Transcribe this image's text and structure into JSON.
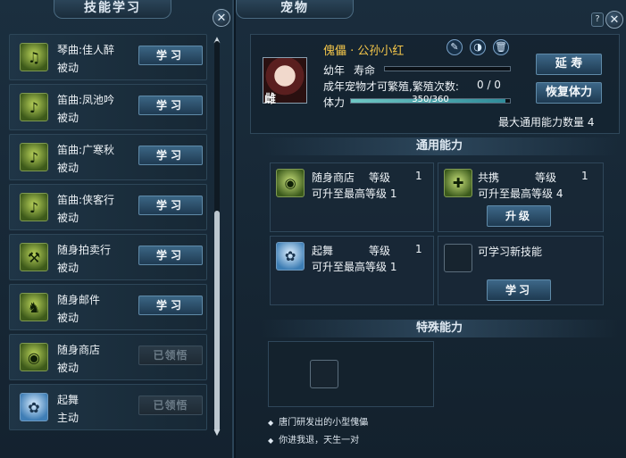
{
  "left_panel": {
    "title": "技能学习",
    "close_icon": "✕",
    "skills": [
      {
        "name": "琴曲:佳人醉",
        "type": "被动",
        "button": "学习",
        "icon": "music-instrument-icon",
        "enabled": true
      },
      {
        "name": "笛曲:凤池吟",
        "type": "被动",
        "button": "学习",
        "icon": "flute-icon",
        "enabled": true
      },
      {
        "name": "笛曲:广寒秋",
        "type": "被动",
        "button": "学习",
        "icon": "flute-icon",
        "enabled": true
      },
      {
        "name": "笛曲:侠客行",
        "type": "被动",
        "button": "学习",
        "icon": "flute-icon",
        "enabled": true
      },
      {
        "name": "随身拍卖行",
        "type": "被动",
        "button": "学习",
        "icon": "auction-hammer-icon",
        "enabled": true
      },
      {
        "name": "随身邮件",
        "type": "被动",
        "button": "学习",
        "icon": "mail-horse-icon",
        "enabled": true
      },
      {
        "name": "随身商店",
        "type": "被动",
        "button": "已领悟",
        "icon": "shop-coin-icon",
        "enabled": false
      },
      {
        "name": "起舞",
        "type": "主动",
        "button": "已领悟",
        "icon": "dance-icon",
        "enabled": false
      }
    ]
  },
  "right_panel": {
    "title": "宠物",
    "help_icon": "?",
    "close_icon": "✕",
    "pet": {
      "name": "傀儡 · 公孙小红",
      "portrait_tag": "雌",
      "youth_label": "幼年",
      "lifespan_label": "寿命",
      "lifespan_fill": 0.0,
      "breed_text": "成年宠物才可繁殖,繁殖次数:",
      "breed_count": "0 / 0",
      "stamina_label": "体力",
      "stamina_value": "350/360",
      "stamina_fill": 0.972,
      "max_ability_text": "最大通用能力数量 4"
    },
    "buttons": {
      "extend_life": "延  寿",
      "restore_stamina": "恢复体力"
    },
    "general_section": {
      "title": "通用能力",
      "abilities": [
        {
          "name": "随身商店",
          "level_label": "等级",
          "level": "1",
          "max_text": "可升至最高等级 1",
          "icon": "shop-coin-icon"
        },
        {
          "name": "共携",
          "level_label": "等级",
          "level": "1",
          "max_text": "可升至最高等级 4",
          "icon": "bag-plus-icon",
          "button": "升级"
        },
        {
          "name": "起舞",
          "level_label": "等级",
          "level": "1",
          "max_text": "可升至最高等级 1",
          "icon": "dance-icon"
        },
        {
          "name": "可学习新技能",
          "icon": "empty-slot-icon",
          "button": "学习"
        }
      ]
    },
    "special_section": {
      "title": "特殊能力"
    },
    "descriptions": [
      "唐门研发出的小型傀儡",
      "你进我退，天生一对"
    ]
  }
}
